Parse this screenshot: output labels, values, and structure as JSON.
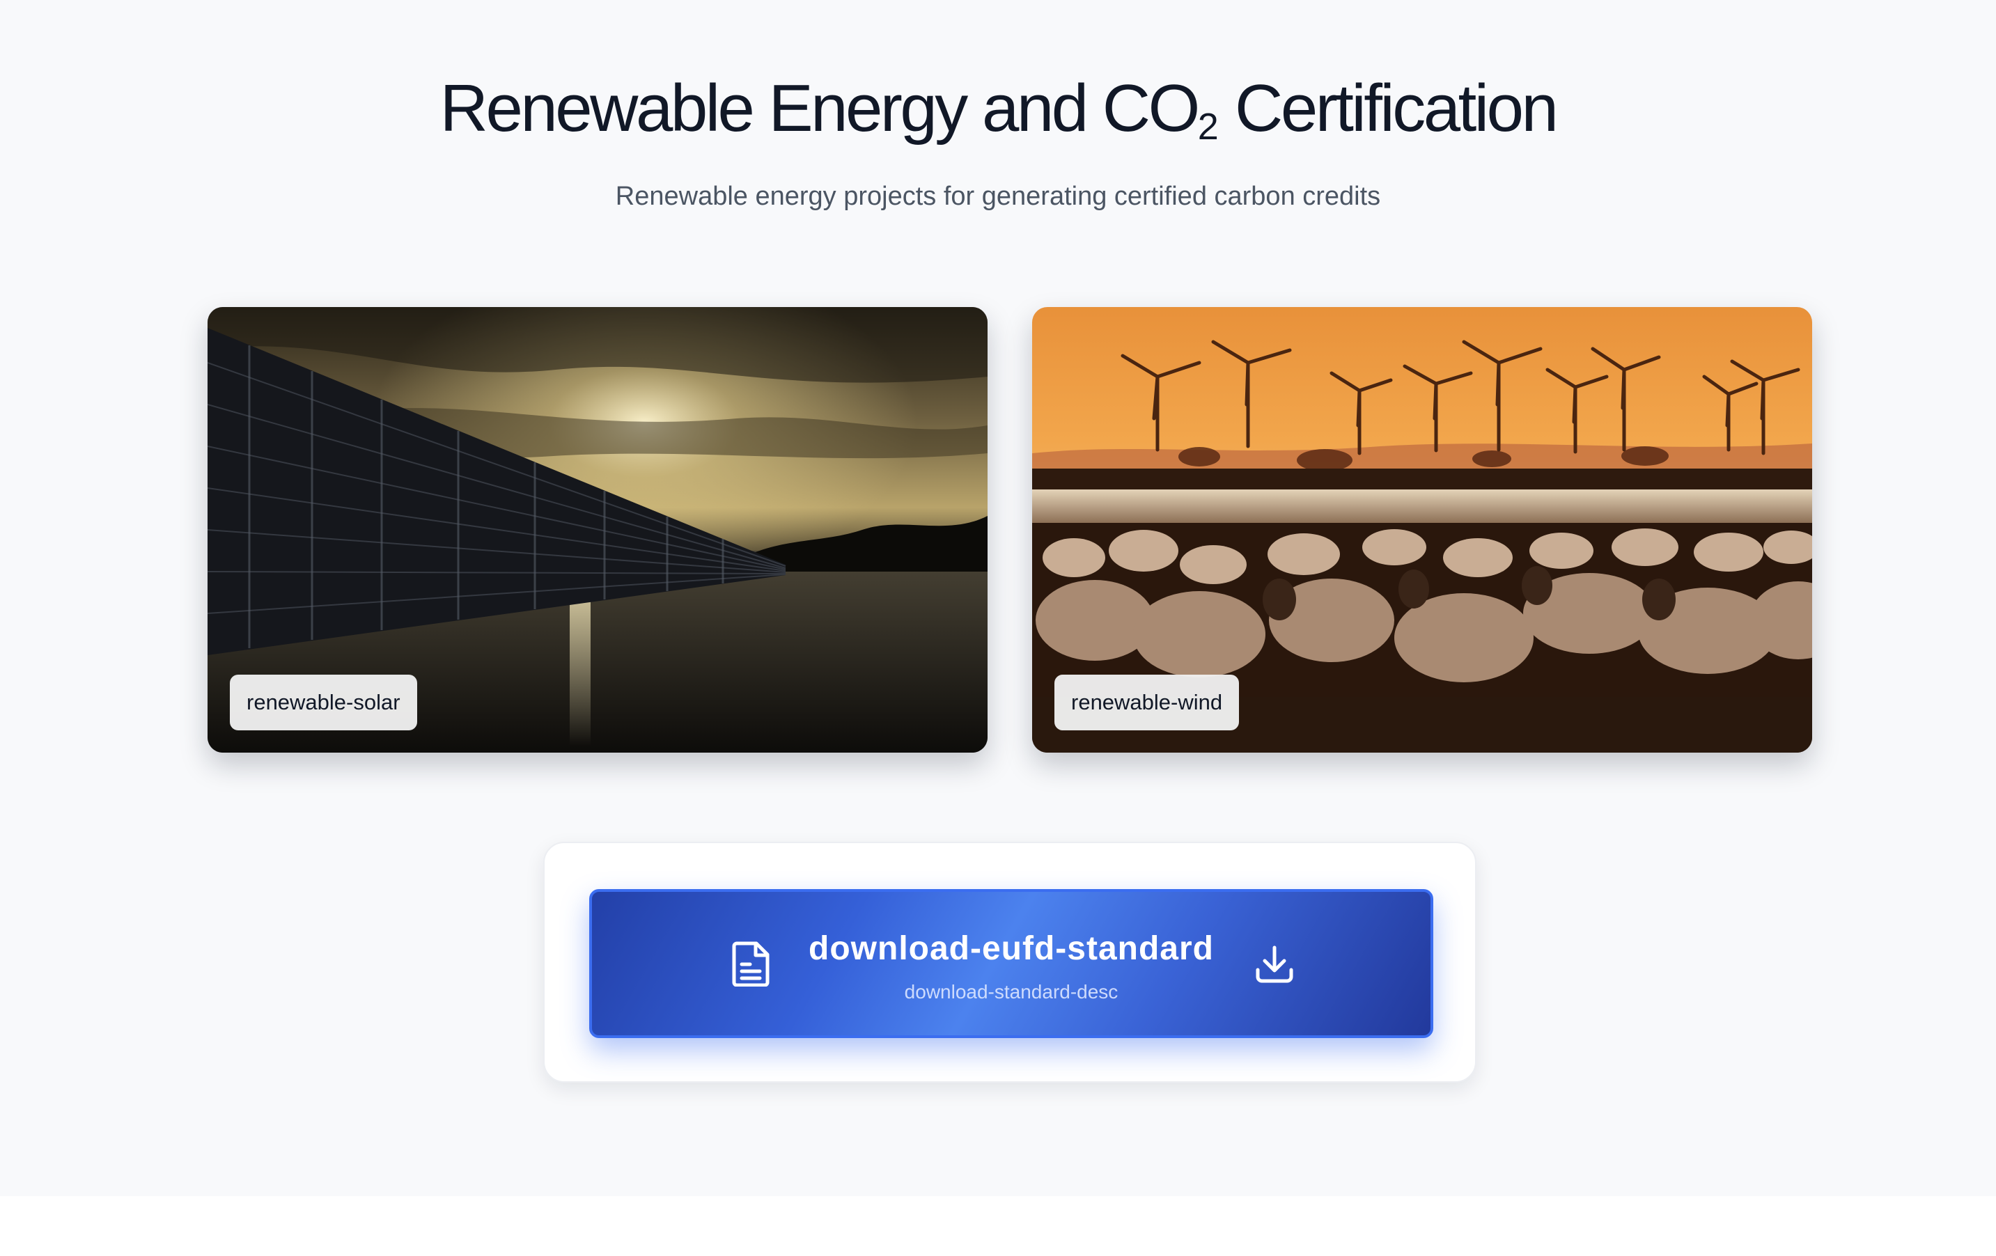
{
  "header": {
    "title_before": "Renewable Energy and CO",
    "title_sub": "2",
    "title_after": " Certification",
    "subtitle": "Renewable energy projects for generating certified carbon credits"
  },
  "projects": [
    {
      "label": "renewable-solar",
      "image": "solar-panels-at-sunset-photo"
    },
    {
      "label": "renewable-wind",
      "image": "sheep-and-wind-turbines-photo"
    }
  ],
  "download": {
    "title": "download-eufd-standard",
    "description": "download-standard-desc",
    "left_icon": "document-icon",
    "right_icon": "download-icon"
  },
  "colors": {
    "page_background": "#f8f9fb",
    "title": "#111827",
    "subtitle": "#4b5563",
    "button_gradient_start": "#2340a8",
    "button_gradient_mid": "#4c82ee",
    "button_border": "#3b6df0"
  }
}
